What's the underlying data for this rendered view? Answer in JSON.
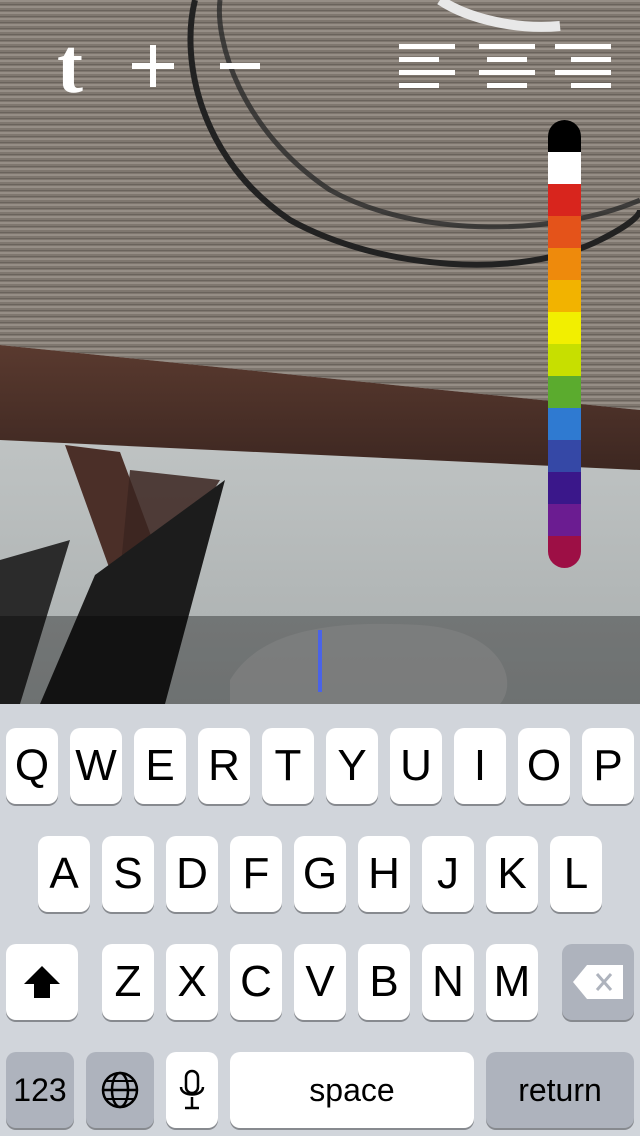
{
  "toolbar": {
    "logo": "t",
    "icons": [
      "tumblr-logo-icon",
      "plus-icon",
      "minus-icon",
      "align-left-icon",
      "align-center-icon",
      "align-right-icon"
    ]
  },
  "palette": {
    "colors": [
      "#000000",
      "#ffffff",
      "#d8251d",
      "#e4531a",
      "#ee8a0c",
      "#f2b300",
      "#f2ef00",
      "#c7df00",
      "#5bab2e",
      "#2f7ad1",
      "#3548a6",
      "#3a178a",
      "#6b1c91",
      "#9d0f45"
    ]
  },
  "editor": {
    "value": ""
  },
  "keyboard": {
    "row1": [
      "Q",
      "W",
      "E",
      "R",
      "T",
      "Y",
      "U",
      "I",
      "O",
      "P"
    ],
    "row2": [
      "A",
      "S",
      "D",
      "F",
      "G",
      "H",
      "J",
      "K",
      "L"
    ],
    "row3": [
      "Z",
      "X",
      "C",
      "V",
      "B",
      "N",
      "M"
    ],
    "shift_icon": "shift-icon",
    "delete_icon": "backspace-icon",
    "numbers_label": "123",
    "globe_icon": "globe-icon",
    "mic_icon": "microphone-icon",
    "space_label": "space",
    "return_label": "return"
  }
}
